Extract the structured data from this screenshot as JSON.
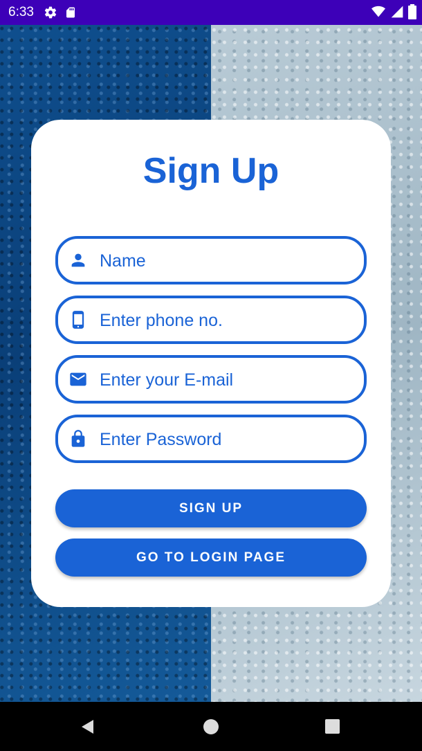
{
  "status_bar": {
    "time": "6:33",
    "icons": [
      "gear-icon",
      "sd-card-icon",
      "wifi-icon",
      "signal-icon",
      "battery-icon"
    ]
  },
  "colors": {
    "primary": "#1a63d6",
    "status_bar": "#3d00b8",
    "card": "#ffffff"
  },
  "form": {
    "title": "Sign Up",
    "fields": [
      {
        "icon": "person-icon",
        "placeholder": "Name",
        "value": ""
      },
      {
        "icon": "phone-icon",
        "placeholder": "Enter phone no.",
        "value": ""
      },
      {
        "icon": "email-icon",
        "placeholder": "Enter your E-mail",
        "value": ""
      },
      {
        "icon": "lock-icon",
        "placeholder": "Enter Password",
        "value": ""
      }
    ],
    "buttons": {
      "sign_up": "SIGN UP",
      "go_to_login": "GO TO LOGIN PAGE"
    }
  },
  "nav_bar": {
    "icons": [
      "back-icon",
      "home-icon",
      "recents-icon"
    ]
  }
}
